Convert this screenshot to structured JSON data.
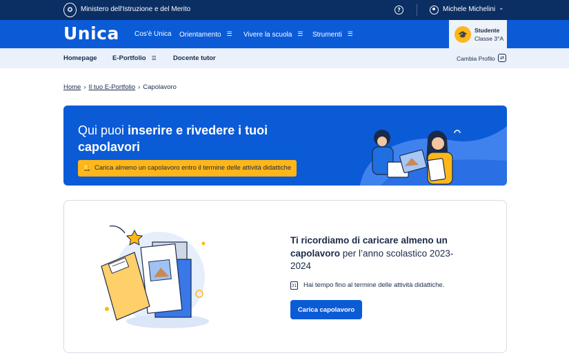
{
  "topbar": {
    "ministry": "Ministero dell'Istruzione e del Merito",
    "user_name": "Michele Michelini",
    "icons": [
      "emblem-icon",
      "help-icon",
      "user-icon",
      "chevron-down-icon"
    ]
  },
  "mainnav": {
    "logo": "Unica",
    "items": [
      {
        "label": "Cos'è Unica",
        "has_menu": false
      },
      {
        "label": "Orientamento",
        "has_menu": true
      },
      {
        "label": "Vivere la scuola",
        "has_menu": true
      },
      {
        "label": "Strumenti",
        "has_menu": true
      }
    ],
    "profile": {
      "role": "Studente",
      "class": "Classe 3°A"
    }
  },
  "subnav": {
    "items": [
      {
        "label": "Homepage"
      },
      {
        "label": "E-Portfolio"
      },
      {
        "label": "Docente tutor"
      }
    ],
    "change_profile": "Cambia Profilo"
  },
  "breadcrumb": {
    "home": "Home",
    "portfolio": "Il tuo E-Portfolio",
    "current": "Capolavoro"
  },
  "hero": {
    "title_plain": "Qui puoi ",
    "title_bold": "inserire e rivedere i tuoi capolavori",
    "alert": "Carica almeno un capolavoro entro il termine delle attività didattiche"
  },
  "card": {
    "heading_bold_1": "Ti ricordiamo di caricare almeno un capolavoro",
    "heading_rest": " per l’anno scolastico 2023-2024",
    "info": "Hai tempo fino al termine delle attività didattiche.",
    "cal_icon_text": "31",
    "button": "Carica capolavoro"
  },
  "colors": {
    "topbar": "#0b2e63",
    "primary": "#0b5bd7",
    "accent": "#ffb619",
    "subnav_bg": "#eaf1fb"
  }
}
